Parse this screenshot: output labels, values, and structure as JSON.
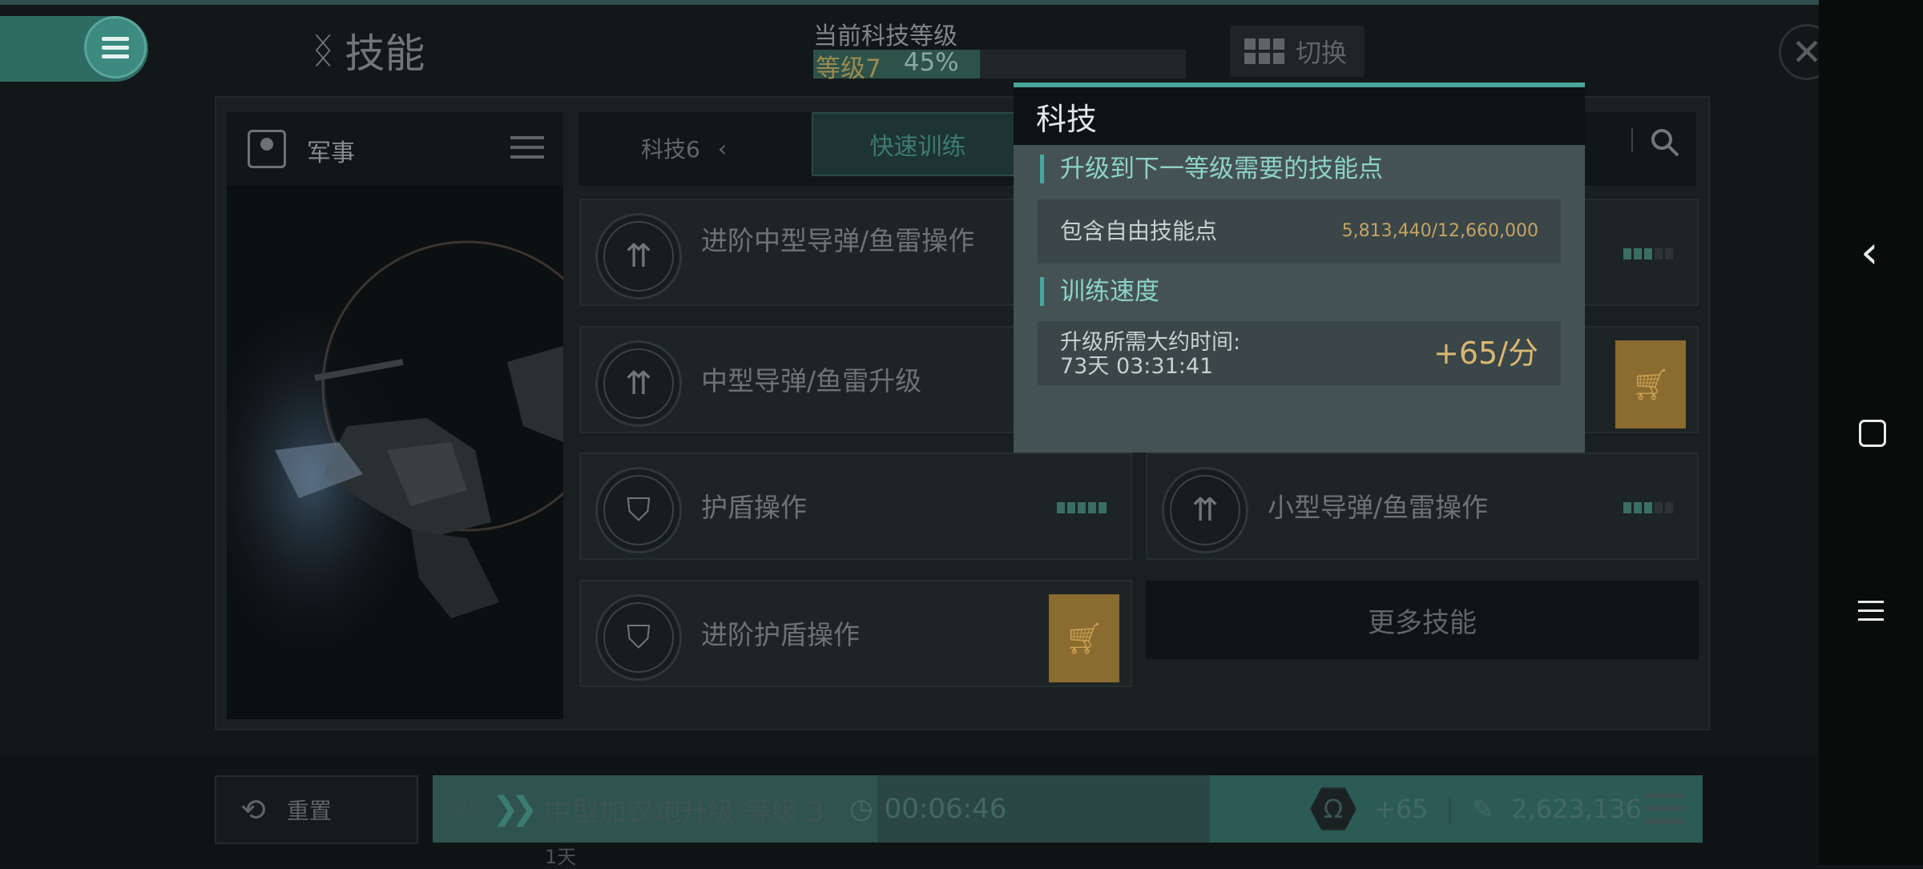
{
  "header": {
    "title": "技能",
    "tech_level_label": "当前科技等级",
    "level_text": "等级7",
    "level_percent": "45%",
    "level_progress": 0.45,
    "switch_label": "切换"
  },
  "category": {
    "label": "军事"
  },
  "tabs": {
    "tech_tab": "科技6",
    "quick_train": "快速训练"
  },
  "skills": [
    {
      "name": "进阶中型导弹/鱼雷操作",
      "icon": "missile-icon",
      "level": 3,
      "max": 5
    },
    {
      "name": "中型导弹/鱼雷升级",
      "icon": "missile-icon",
      "cart": true
    },
    {
      "name": "护盾操作",
      "icon": "shield-icon",
      "level": 5,
      "max": 5
    },
    {
      "name": "小型导弹/鱼雷操作",
      "icon": "missile-icon",
      "level": 3,
      "max": 5
    },
    {
      "name": "进阶护盾操作",
      "icon": "shield-icon",
      "cart": true
    }
  ],
  "more_skills": "更多技能",
  "bottom": {
    "reset": "重置",
    "queue_skill": "中型加农炮升级 等级 3",
    "queue_time": "00:06:46",
    "rate": "+65",
    "points": "2,623,136",
    "day_label": "1天"
  },
  "popup": {
    "title": "科技",
    "section1_title": "升级到下一等级需要的技能点",
    "free_points_label": "包含自由技能点",
    "free_points_value": "5,813,440/12,660,000",
    "section2_title": "训练速度",
    "eta_label": "升级所需大约时间:",
    "eta_value": "73天 03:31:41",
    "speed": "+65/分"
  },
  "colors": {
    "accent": "#49a69a",
    "gold": "#d9b672",
    "cart": "#8a6b30"
  }
}
